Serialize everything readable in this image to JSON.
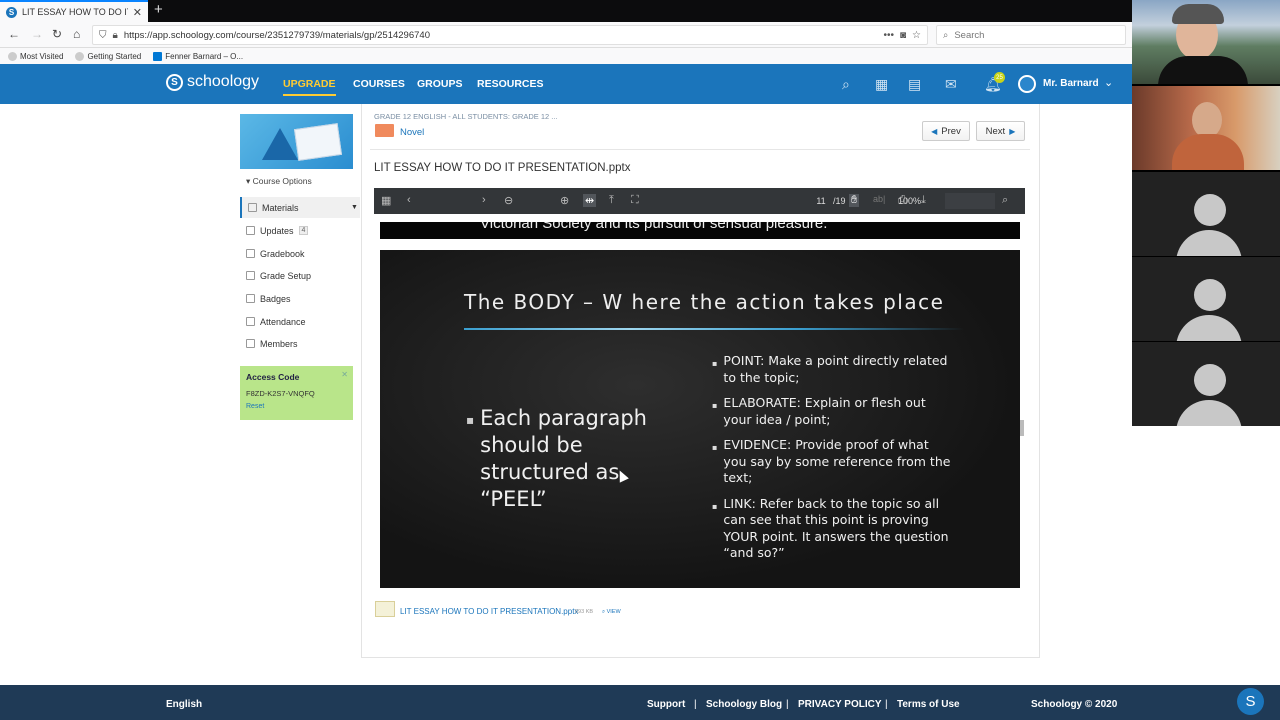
{
  "browser": {
    "tab_title": "LIT ESSAY HOW TO DO IT PRES",
    "url": "https://app.schoology.com/course/2351279739/materials/gp/2514296740",
    "search_placeholder": "Search",
    "bookmarks": [
      "Most Visited",
      "Getting Started",
      "Fenner Barnard – O..."
    ]
  },
  "header": {
    "logo": "schoology",
    "nav": [
      "UPGRADE",
      "COURSES",
      "GROUPS",
      "RESOURCES"
    ],
    "notifications": "25",
    "user": "Mr. Barnard"
  },
  "sidebar": {
    "course_options": "Course Options",
    "items": [
      {
        "label": "Materials",
        "icon": "materials-icon"
      },
      {
        "label": "Updates",
        "count": "4",
        "icon": "updates-icon"
      },
      {
        "label": "Gradebook",
        "icon": "gradebook-icon"
      },
      {
        "label": "Grade Setup",
        "icon": "grade-setup-icon"
      },
      {
        "label": "Badges",
        "icon": "badges-icon"
      },
      {
        "label": "Attendance",
        "icon": "attendance-icon"
      },
      {
        "label": "Members",
        "icon": "members-icon"
      }
    ],
    "access": {
      "title": "Access Code",
      "code": "F8ZD-K2S7-VNQFQ",
      "reset": "Reset"
    }
  },
  "content": {
    "breadcrumb": "GRADE 12 ENGLISH - ALL STUDENTS: GRADE 12 ...",
    "folder": "Novel",
    "prev": "Prev",
    "next": "Next",
    "doc_title": "LIT ESSAY HOW TO DO IT PRESENTATION.pptx",
    "viewer": {
      "page": "11",
      "total": "/19",
      "zoom": "100%"
    },
    "prev_slide_text": "Victorian Society and its pursuit of sensual pleasure.",
    "slide": {
      "title": "The BODY – W here the action takes place",
      "left": "Each paragraph should be structured as “PEEL”",
      "points": [
        "POINT: Make a point directly related to the topic;",
        "ELABORATE: Explain or flesh out your idea / point;",
        "EVIDENCE: Provide proof of what you say by some reference from the text;",
        "LINK: Refer back to the topic so all can see that this point is proving YOUR point. It answers the question “and so?”"
      ]
    },
    "attachment": {
      "name": "LIT ESSAY HOW TO DO IT PRESENTATION.pptx",
      "size": "693 KB",
      "view": "VIEW"
    }
  },
  "footer": {
    "language": "English",
    "links": [
      "Support",
      "Schoology Blog",
      "PRIVACY POLICY",
      "Terms of Use"
    ],
    "copyright": "Schoology © 2020"
  },
  "colors": {
    "brand": "#1b75bb",
    "accent": "#ffcc33",
    "footer": "#1f3a56",
    "access_code_bg": "#b9e58a"
  }
}
